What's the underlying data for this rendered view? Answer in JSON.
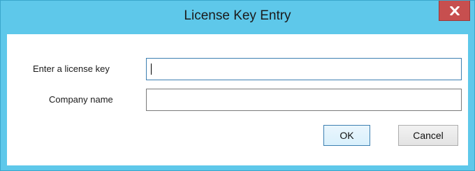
{
  "window": {
    "title": "License Key Entry",
    "close_icon": "close-icon"
  },
  "form": {
    "license_key": {
      "label": "Enter a license key",
      "value": "",
      "focused": true
    },
    "company_name": {
      "label": "Company name",
      "value": ""
    }
  },
  "buttons": {
    "ok_label": "OK",
    "cancel_label": "Cancel"
  },
  "colors": {
    "titlebar": "#5ec8ea",
    "close_button": "#c74f4f",
    "focus_border": "#3c7fb1"
  }
}
